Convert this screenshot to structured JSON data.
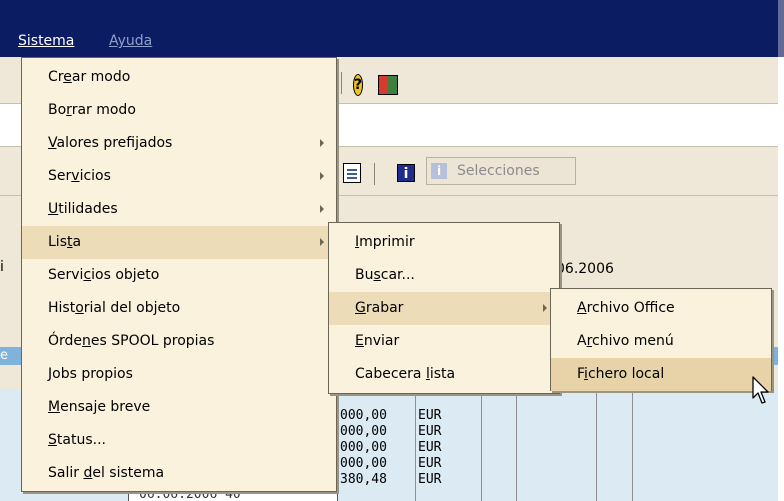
{
  "menubar": {
    "items": [
      "Sistema",
      "Ayuda"
    ]
  },
  "toolbar": {
    "help_icon_glyph": "?",
    "selecciones_label": "Selecciones",
    "info_icon_glyph": "i"
  },
  "background": {
    "date_fragment": "06.2006",
    "left_fragment": "i",
    "header_fragment": "e",
    "rows": [
      {
        "amount": "000,00",
        "currency": "EUR"
      },
      {
        "amount": "000,00",
        "currency": "EUR"
      },
      {
        "amount": "000,00",
        "currency": "EUR"
      },
      {
        "amount": "000,00",
        "currency": "EUR"
      },
      {
        "amount": "380,48",
        "currency": "EUR"
      }
    ],
    "last_row_fragment": "06.06.2006 40"
  },
  "sistema_menu": {
    "items": [
      {
        "pre": "Cr",
        "u": "e",
        "post": "ar modo",
        "submenu": false
      },
      {
        "pre": "Bo",
        "u": "r",
        "post": "rar modo",
        "submenu": false
      },
      {
        "pre": "",
        "u": "V",
        "post": "alores prefijados",
        "submenu": true
      },
      {
        "pre": "Ser",
        "u": "v",
        "post": "icios",
        "submenu": true
      },
      {
        "pre": "",
        "u": "U",
        "post": "tilidades",
        "submenu": true
      },
      {
        "pre": "Lis",
        "u": "t",
        "post": "a",
        "submenu": true
      },
      {
        "pre": "Servi",
        "u": "c",
        "post": "ios objeto",
        "submenu": false
      },
      {
        "pre": "Hist",
        "u": "o",
        "post": "rial del objeto",
        "submenu": false
      },
      {
        "pre": "Órde",
        "u": "n",
        "post": "es SPOOL propias",
        "submenu": false
      },
      {
        "pre": "",
        "u": "J",
        "post": "obs propios",
        "submenu": false
      },
      {
        "pre": "",
        "u": "M",
        "post": "ensaje breve",
        "submenu": false
      },
      {
        "pre": "",
        "u": "S",
        "post": "tatus...",
        "submenu": false
      },
      {
        "pre": "Salir ",
        "u": "d",
        "post": "el sistema",
        "submenu": false
      }
    ]
  },
  "lista_menu": {
    "items": [
      {
        "pre": "",
        "u": "I",
        "post": "mprimir",
        "submenu": false
      },
      {
        "pre": "Bu",
        "u": "s",
        "post": "car...",
        "submenu": false
      },
      {
        "pre": "",
        "u": "G",
        "post": "rabar",
        "submenu": true
      },
      {
        "pre": "",
        "u": "E",
        "post": "nviar",
        "submenu": false
      },
      {
        "pre": "Cabecera ",
        "u": "l",
        "post": "ista",
        "submenu": false
      }
    ]
  },
  "grabar_menu": {
    "items": [
      {
        "pre": "",
        "u": "A",
        "post": "rchivo Office"
      },
      {
        "pre": "A",
        "u": "r",
        "post": "chivo menú"
      },
      {
        "pre": "F",
        "u": "i",
        "post": "chero local"
      }
    ]
  },
  "colors": {
    "titlebar": "#0c1c62",
    "menu_bg": "#fbf2dd",
    "menu_highlight": "#e7d3a7",
    "app_bg": "#efe8d8",
    "grid_bg": "#dbeaf3",
    "header_blue": "#7fb3dc"
  }
}
